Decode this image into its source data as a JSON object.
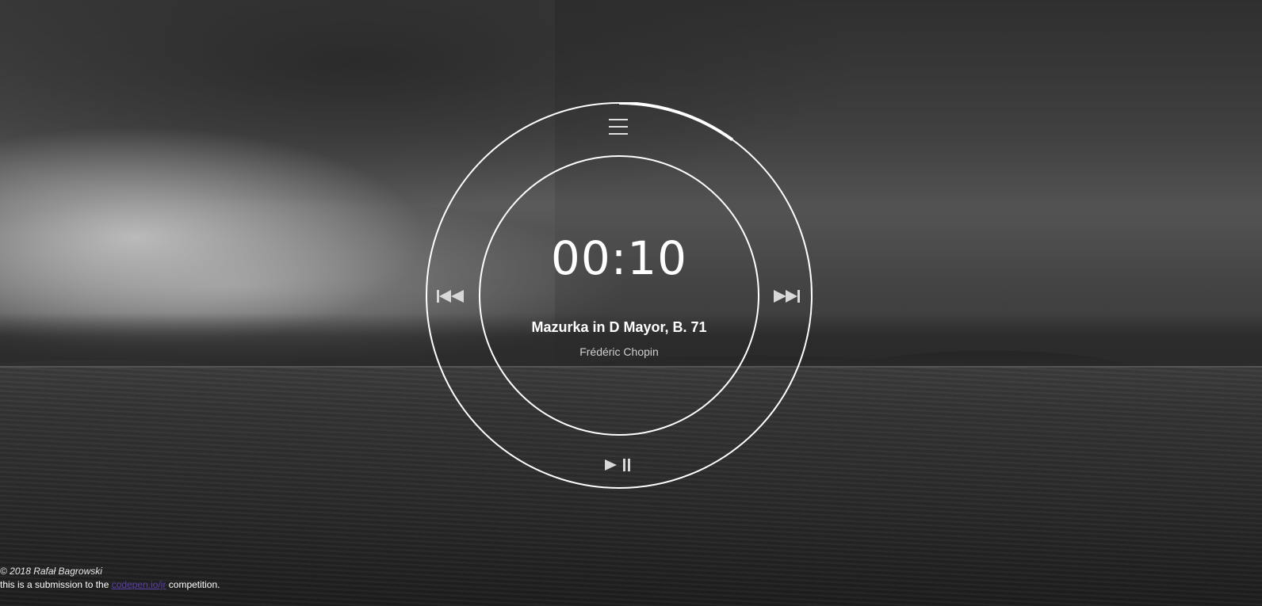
{
  "player": {
    "time": "00:10",
    "track_title": "Mazurka in D Mayor, B. 71",
    "artist": "Frédéric Chopin",
    "progress": 0.1,
    "menu_icon": "hamburger-menu-icon",
    "prev_icon": "skip-previous-icon",
    "next_icon": "skip-next-icon",
    "play_icon": "play-icon",
    "pause_icon": "pause-icon"
  },
  "footer": {
    "copyright": "© 2018 Rafał Bagrowski",
    "submission_prefix": "this is a submission to the ",
    "link_text": "codepen.io/jr",
    "submission_suffix": " competition."
  },
  "colors": {
    "ring": "#ffffff",
    "link": "#5a3fa8"
  }
}
